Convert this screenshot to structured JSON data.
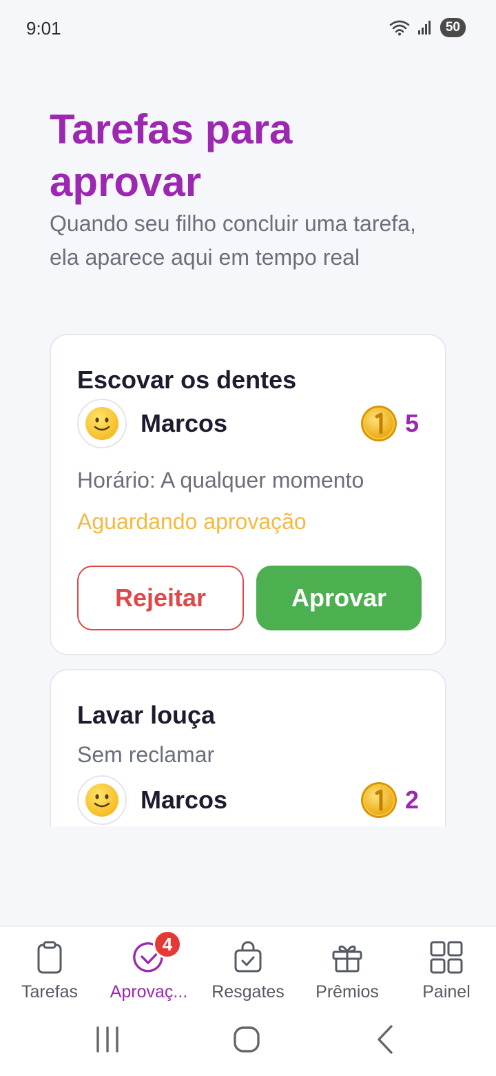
{
  "status_bar": {
    "time": "9:01",
    "battery": "50"
  },
  "header": {
    "title": "Tarefas para aprovar",
    "subtitle": "Quando seu filho concluir uma tarefa, ela aparece aqui em tempo real"
  },
  "tasks": [
    {
      "title": "Escovar os dentes",
      "child": "Marcos",
      "points": "5",
      "schedule": "Horário: A qualquer momento",
      "status": "Aguardando aprovação",
      "reject_label": "Rejeitar",
      "approve_label": "Aprovar"
    },
    {
      "title": "Lavar louça",
      "description": "Sem reclamar",
      "child": "Marcos",
      "points": "2"
    }
  ],
  "bottom_nav": {
    "items": [
      {
        "label": "Tarefas",
        "icon": "clipboard-icon"
      },
      {
        "label": "Aprovaç...",
        "icon": "check-circle-icon",
        "badge": "4",
        "active": true
      },
      {
        "label": "Resgates",
        "icon": "bag-check-icon"
      },
      {
        "label": "Prêmios",
        "icon": "gift-icon"
      },
      {
        "label": "Painel",
        "icon": "grid-icon"
      }
    ]
  },
  "colors": {
    "brand": "#9C27B0",
    "approve": "#4CAF50",
    "reject": "#E04848",
    "pending": "#F4B942",
    "badge": "#E53935"
  }
}
